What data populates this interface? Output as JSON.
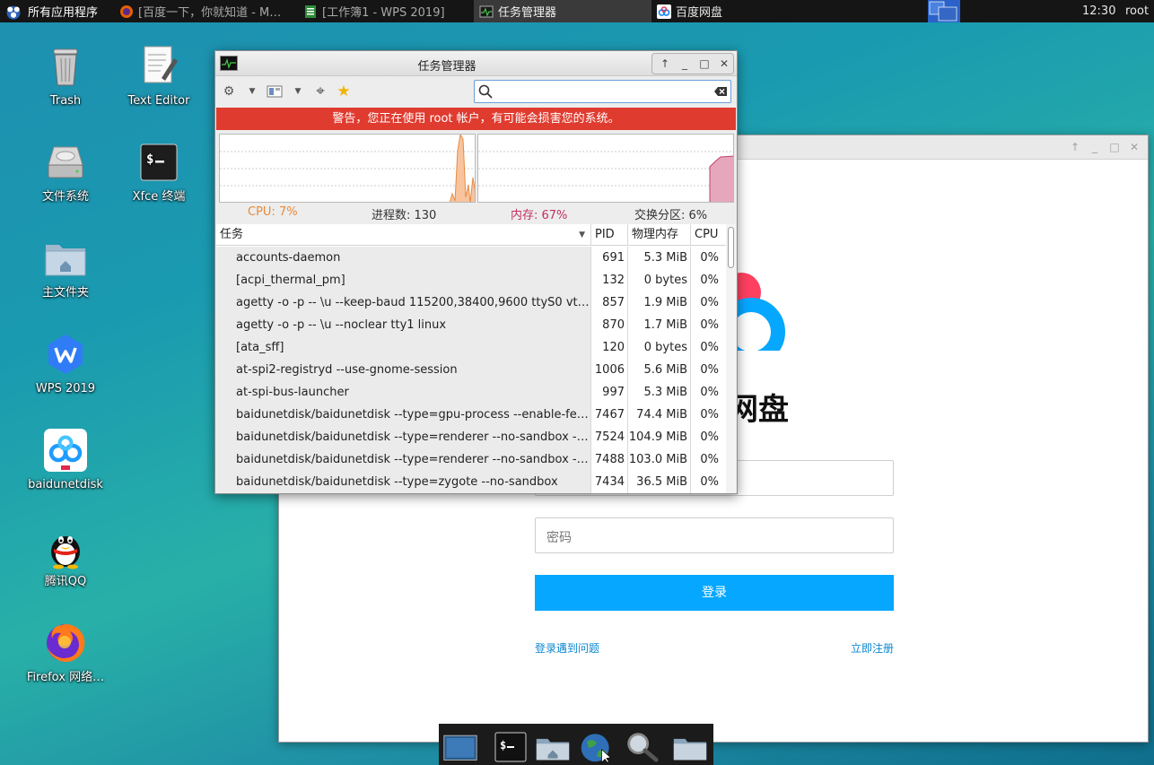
{
  "top_panel": {
    "apps_menu": "所有应用程序",
    "tasks": [
      {
        "label": "[百度一下，你就知道 - M…",
        "icon": "firefox-icon"
      },
      {
        "label": "[工作簿1 - WPS 2019]",
        "icon": "spreadsheet-icon"
      },
      {
        "label": "任务管理器",
        "icon": "task-manager-icon"
      },
      {
        "label": "百度网盘",
        "icon": "baidunetdisk-icon"
      }
    ],
    "clock": "12:30",
    "user": "root"
  },
  "desktop_icons": [
    {
      "label": "Trash",
      "icon": "trash-icon"
    },
    {
      "label": "Text Editor",
      "icon": "text-editor-icon"
    },
    {
      "label": "文件系统",
      "icon": "hard-drive-icon"
    },
    {
      "label": "Xfce 终端",
      "icon": "terminal-icon"
    },
    {
      "label": "主文件夹",
      "icon": "home-folder-icon"
    },
    {
      "label": "WPS 2019",
      "icon": "wps-icon"
    },
    {
      "label": "baidunetdisk",
      "icon": "baidunetdisk-icon"
    },
    {
      "label": "腾讯QQ",
      "icon": "qq-penguin-icon"
    },
    {
      "label": "Firefox 网络…",
      "icon": "firefox-icon"
    }
  ],
  "baidu_window": {
    "brand_text": "网盘",
    "password_placeholder": "密码",
    "login_button": "登录",
    "login_problem_link": "登录遇到问题",
    "register_link": "立即注册"
  },
  "task_manager": {
    "title": "任务管理器",
    "search_value": "",
    "warning": "警告，您正在使用 root 帐户，有可能会损害您的系统。",
    "stats": {
      "cpu": "CPU: 7%",
      "processes": "进程数: 130",
      "memory": "内存: 67%",
      "swap": "交换分区: 6%"
    },
    "colors": {
      "cpu": "#f0a060",
      "memory": "#c04060",
      "warning": "#e03b2f"
    },
    "columns": {
      "task": "任务",
      "pid": "PID",
      "memory": "物理内存",
      "cpu": "CPU"
    },
    "rows": [
      {
        "task": "accounts-daemon",
        "pid": "691",
        "mem": "5.3 MiB",
        "cpu": "0%"
      },
      {
        "task": "[acpi_thermal_pm]",
        "pid": "132",
        "mem": "0 bytes",
        "cpu": "0%"
      },
      {
        "task": "agetty -o -p -- \\u --keep-baud 115200,38400,9600 ttyS0 vt220",
        "pid": "857",
        "mem": "1.9 MiB",
        "cpu": "0%"
      },
      {
        "task": "agetty -o -p -- \\u --noclear tty1 linux",
        "pid": "870",
        "mem": "1.7 MiB",
        "cpu": "0%"
      },
      {
        "task": "[ata_sff]",
        "pid": "120",
        "mem": "0 bytes",
        "cpu": "0%"
      },
      {
        "task": "at-spi2-registryd --use-gnome-session",
        "pid": "1006",
        "mem": "5.6 MiB",
        "cpu": "0%"
      },
      {
        "task": "at-spi-bus-launcher",
        "pid": "997",
        "mem": "5.3 MiB",
        "cpu": "0%"
      },
      {
        "task": "baidunetdisk/baidunetdisk --type=gpu-process --enable-feat…",
        "pid": "7467",
        "mem": "74.4 MiB",
        "cpu": "0%"
      },
      {
        "task": "baidunetdisk/baidunetdisk --type=renderer --no-sandbox --en…",
        "pid": "7524",
        "mem": "104.9 MiB",
        "cpu": "0%"
      },
      {
        "task": "baidunetdisk/baidunetdisk --type=renderer --no-sandbox --en…",
        "pid": "7488",
        "mem": "103.0 MiB",
        "cpu": "0%"
      },
      {
        "task": "baidunetdisk/baidunetdisk --type=zygote --no-sandbox",
        "pid": "7434",
        "mem": "36.5 MiB",
        "cpu": "0%"
      }
    ]
  },
  "dock": [
    {
      "icon": "show-desktop-icon"
    },
    {
      "icon": "terminal-icon"
    },
    {
      "icon": "home-folder-icon"
    },
    {
      "icon": "web-browser-icon"
    },
    {
      "icon": "search-icon"
    },
    {
      "icon": "file-manager-icon"
    }
  ]
}
